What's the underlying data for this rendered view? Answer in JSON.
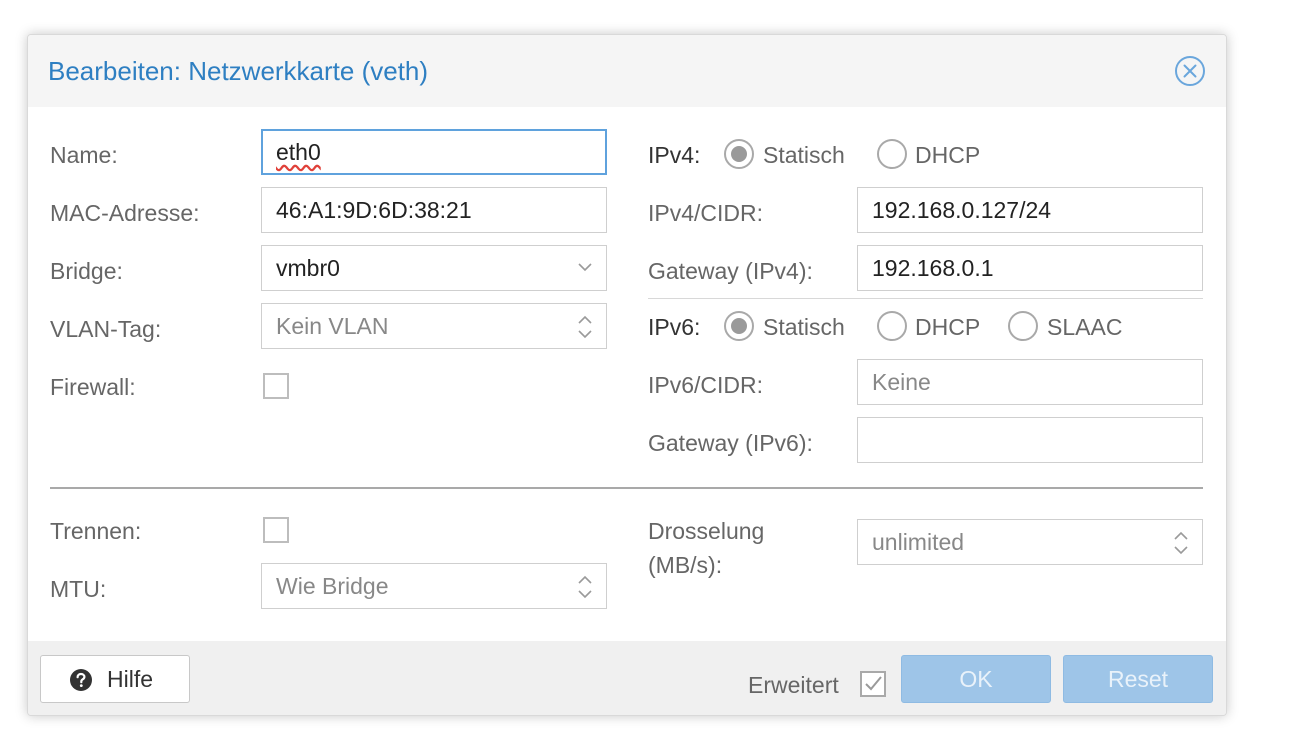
{
  "dialog": {
    "title": "Bearbeiten: Netzwerkkarte (veth)"
  },
  "left": {
    "name_label": "Name:",
    "name_value": "eth0",
    "mac_label": "MAC-Adresse:",
    "mac_value": "46:A1:9D:6D:38:21",
    "bridge_label": "Bridge:",
    "bridge_value": "vmbr0",
    "vlan_label": "VLAN-Tag:",
    "vlan_value": "Kein VLAN",
    "firewall_label": "Firewall:",
    "firewall_checked": false
  },
  "right": {
    "ipv4_label": "IPv4:",
    "ipv4_static": "Statisch",
    "ipv4_dhcp": "DHCP",
    "ipv4_cidr_label": "IPv4/CIDR:",
    "ipv4_cidr_value": "192.168.0.127/24",
    "gateway4_label": "Gateway (IPv4):",
    "gateway4_value": "192.168.0.1",
    "ipv6_label": "IPv6:",
    "ipv6_static": "Statisch",
    "ipv6_dhcp": "DHCP",
    "ipv6_slaac": "SLAAC",
    "ipv6_cidr_label": "IPv6/CIDR:",
    "ipv6_cidr_placeholder": "Keine",
    "gateway6_label": "Gateway (IPv6):",
    "gateway6_value": ""
  },
  "advanced": {
    "disconnect_label": "Trennen:",
    "disconnect_checked": false,
    "mtu_label": "MTU:",
    "mtu_value": "Wie Bridge",
    "rate_label_line1": "Drosselung",
    "rate_label_line2": "(MB/s):",
    "rate_value": "unlimited"
  },
  "footer": {
    "help_label": "Hilfe",
    "advanced_label": "Erweitert",
    "advanced_checked": true,
    "ok_label": "OK",
    "reset_label": "Reset"
  },
  "colors": {
    "title": "#2e7fc2",
    "primary_button": "#9ec5e8",
    "focus_border": "#5fa2dd"
  }
}
